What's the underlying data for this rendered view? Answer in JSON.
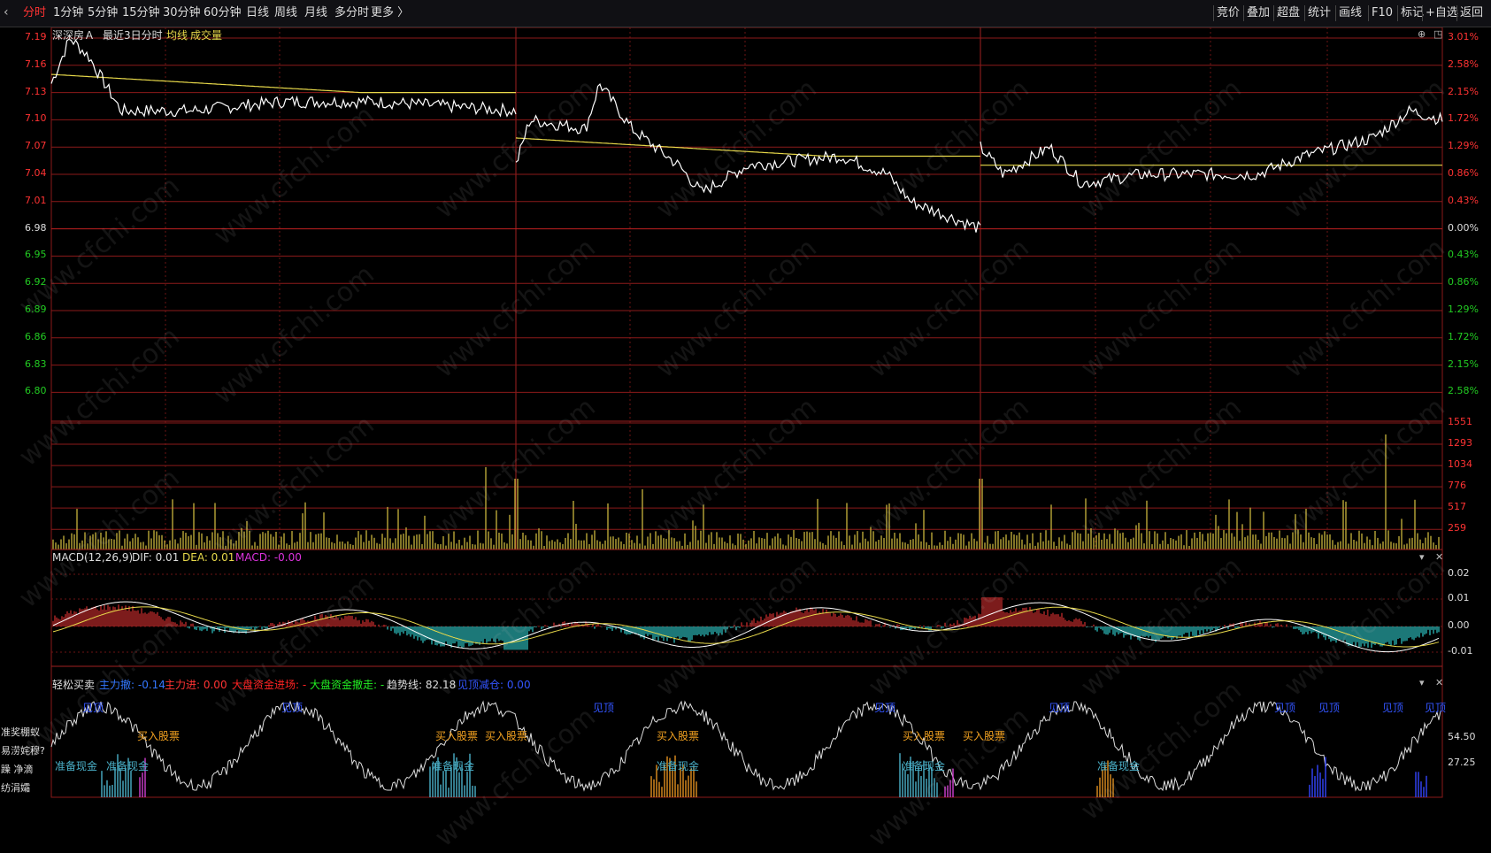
{
  "topbar": {
    "tabs": [
      "分时",
      "1分钟",
      "5分钟",
      "15分钟",
      "30分钟",
      "60分钟",
      "日线",
      "周线",
      "月线",
      "多分时",
      "更多 〉"
    ],
    "active_tab": "分时",
    "tools": [
      "竞价",
      "叠加",
      "超盘",
      "统计",
      "画线",
      "F10",
      "标记",
      "+自选",
      "返回"
    ]
  },
  "header": {
    "stock_name": "深深房Ａ",
    "period": "最近3日分时",
    "avg_label": "均线",
    "vol_label": "成交量"
  },
  "price_axis": {
    "left": [
      "7.19",
      "7.16",
      "7.13",
      "7.10",
      "7.07",
      "7.04",
      "7.01",
      "6.98",
      "6.95",
      "6.92",
      "6.89",
      "6.86",
      "6.83",
      "6.80"
    ],
    "right": [
      "3.01%",
      "2.58%",
      "2.15%",
      "1.72%",
      "1.29%",
      "0.86%",
      "0.43%",
      "0.00%",
      "0.43%",
      "0.86%",
      "1.29%",
      "1.72%",
      "2.15%",
      "2.58%"
    ]
  },
  "volume_axis": [
    "1551",
    "1293",
    "1034",
    "776",
    "517",
    "259"
  ],
  "macd": {
    "title": "MACD(12,26,9)",
    "dif": "DIF: 0.01",
    "dea": "DEA: 0.01",
    "macd": "MACD: -0.00",
    "axis": [
      "0.02",
      "0.01",
      "0.00",
      "-0.01"
    ]
  },
  "indicator": {
    "title": "轻松买卖",
    "items": [
      {
        "text": "主力撤: -0.14",
        "color": "#3377ff"
      },
      {
        "text": "主力进: 0.00",
        "color": "#ff3333"
      },
      {
        "text": "大盘资金进场: -",
        "color": "#ff2222"
      },
      {
        "text": "大盘资金撤走: -",
        "color": "#22ee22"
      },
      {
        "text": "趋势线: 82.18",
        "color": "#dddddd"
      },
      {
        "text": "见顶减仓: 0.00",
        "color": "#3355ff"
      }
    ],
    "axis": [
      "54.50",
      "27.25"
    ],
    "labels_top": [
      "见顶",
      "见顶",
      "见顶",
      "见顶",
      "见顶",
      "见顶",
      "见顶",
      "见顶",
      "见顶"
    ],
    "labels_buy": [
      "买入股票",
      "买入股票",
      "买入股票",
      "买入股票",
      "买入股票",
      "买入股票"
    ],
    "labels_cash": [
      "准备现金",
      "准备现金",
      "准备现金",
      "准备现金",
      "准备现金",
      "准备现金"
    ]
  },
  "left_panel": [
    "准奖棚蚁",
    "易涝姹穆?",
    "躁 净滴",
    "纺涓孀"
  ],
  "watermark": "www.cfchi.com",
  "colors": {
    "price_line": "#ffffff",
    "avg_line": "#e8d94a",
    "grid": "#8b1a1a",
    "up": "#ff3333",
    "down": "#22cc22",
    "volume": "#c8b43c",
    "macd_pos": "#d03030",
    "macd_neg": "#30c8c8"
  }
}
